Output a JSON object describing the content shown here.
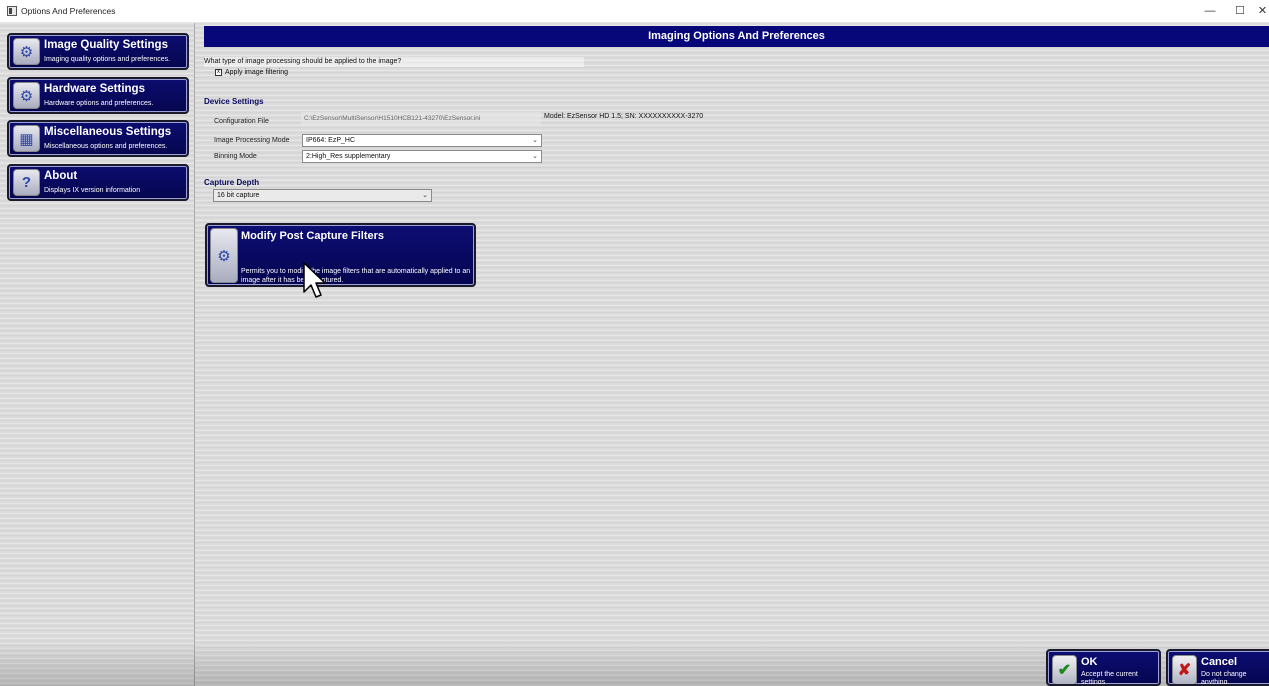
{
  "window": {
    "title": "Options And Preferences",
    "min_glyph": "—",
    "max_glyph": "☐",
    "close_glyph": "✕"
  },
  "sidebar": {
    "items": [
      {
        "label": "Image Quality Settings",
        "sub": "Imaging quality options and preferences.",
        "icon": "image-quality-icon"
      },
      {
        "label": "Hardware Settings",
        "sub": "Hardware options and preferences.",
        "icon": "hardware-gear-icon"
      },
      {
        "label": "Miscellaneous Settings",
        "sub": "Miscellaneous options and preferences.",
        "icon": "calendar-icon"
      },
      {
        "label": "About",
        "sub": "Displays IX version information",
        "icon": "help-question-icon"
      }
    ]
  },
  "main": {
    "header": "Imaging Options And Preferences",
    "question": "What type of image processing should be applied to the image?",
    "apply_filtering": {
      "label": "Apply image filtering",
      "checked": true,
      "glyph": "x"
    },
    "device_settings": {
      "title": "Device Settings",
      "config_label": "Configuration File",
      "config_value": "C:\\EzSensor\\MultiSensor\\H1510HCB121-43270\\EzSensor.ini",
      "model_text": "Model: EzSensor HD 1.5; SN: XXXXXXXXXX-3270",
      "processing_label": "Image Processing Mode",
      "processing_value": "IP664: EzP_HC",
      "binning_label": "Binning Mode",
      "binning_value": "2:High_Res supplementary"
    },
    "capture_depth": {
      "title": "Capture Depth",
      "value": "16 bit capture"
    },
    "modify_filters": {
      "label": "Modify Post Capture Filters",
      "sub": "Permits you to modify the image filters that are automatically applied to an image after it has been captured."
    }
  },
  "footer": {
    "ok": {
      "label": "OK",
      "sub": "Accept the current settings",
      "glyph": "✔",
      "color": "#1e8a1e"
    },
    "cancel": {
      "label": "Cancel",
      "sub": "Do not change anything.",
      "glyph": "✘",
      "color": "#c01818"
    }
  },
  "colors": {
    "accent": "#07077a",
    "button_dark": "#050550"
  }
}
